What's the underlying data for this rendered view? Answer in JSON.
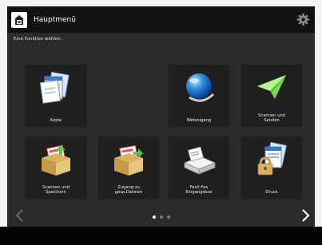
{
  "header": {
    "title": "Hauptmenü",
    "home_icon": "home-icon",
    "settings_icon": "gear-icon"
  },
  "instruction": "Eine Funktion wählen.",
  "tiles": [
    {
      "label": "Kopie",
      "icon": "copy-documents-icon"
    },
    {
      "label": "Webzugang",
      "icon": "globe-icon"
    },
    {
      "label": "Scannen und\nSenden",
      "icon": "paper-plane-icon"
    },
    {
      "label": "Scannen und\nSpeichern",
      "icon": "scan-to-box-icon"
    },
    {
      "label": "Zugang zu\ngesp.Dateien",
      "icon": "stored-files-icon"
    },
    {
      "label": "Fax/I-Fax\nEingangsbox",
      "icon": "fax-inbox-icon"
    },
    {
      "label": "Druck",
      "icon": "secure-print-icon"
    }
  ],
  "pager": {
    "pages": 3,
    "current": 1
  },
  "colors": {
    "header": "#111111",
    "background": "#2b2b2b",
    "tile": "#1f1f1f"
  }
}
